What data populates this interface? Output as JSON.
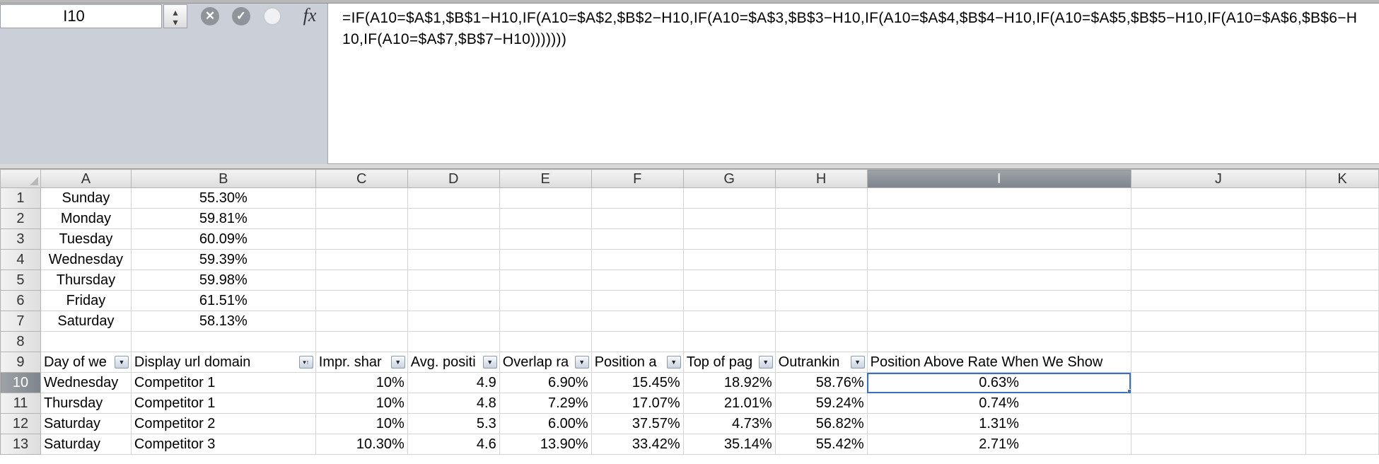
{
  "name_box": {
    "value": "I10"
  },
  "formula_bar": {
    "fx_label": "fx",
    "formula": "=IF(A10=$A$1,$B$1−H10,IF(A10=$A$2,$B$2−H10,IF(A10=$A$3,$B$3−H10,IF(A10=$A$4,$B$4−H10,IF(A10=$A$5,$B$5−H10,IF(A10=$A$6,$B$6−H10,IF(A10=$A$7,$B$7−H10)))))))"
  },
  "icons": {
    "cancel": "close-icon",
    "enter": "check-icon",
    "function": "function-icon",
    "stepper": "stepper-icon"
  },
  "colors": {
    "selection": "#3a6fc4",
    "filter_button": "#c9d3df"
  },
  "columns": [
    "A",
    "B",
    "C",
    "D",
    "E",
    "F",
    "G",
    "H",
    "I",
    "J",
    "K"
  ],
  "selected_column": "I",
  "selected_row": "10",
  "rows": [
    {
      "num": "1",
      "A": "Sunday",
      "B": "55.30%"
    },
    {
      "num": "2",
      "A": "Monday",
      "B": "59.81%"
    },
    {
      "num": "3",
      "A": "Tuesday",
      "B": "60.09%"
    },
    {
      "num": "4",
      "A": "Wednesday",
      "B": "59.39%"
    },
    {
      "num": "5",
      "A": "Thursday",
      "B": "59.98%"
    },
    {
      "num": "6",
      "A": "Friday",
      "B": "61.51%"
    },
    {
      "num": "7",
      "A": "Saturday",
      "B": "58.13%"
    },
    {
      "num": "8"
    }
  ],
  "table_header": {
    "num": "9",
    "A": "Day of we",
    "B": "Display url domain",
    "C": "Impr. shar",
    "D": "Avg. positi",
    "E": "Overlap ra",
    "F": "Position a",
    "G": "Top of pag",
    "H": "Outrankin",
    "I": "Position Above Rate When We Show"
  },
  "table_rows": [
    {
      "num": "10",
      "A": "Wednesday",
      "B": "Competitor 1",
      "C": "10%",
      "D": "4.9",
      "E": "6.90%",
      "F": "15.45%",
      "G": "18.92%",
      "H": "58.76%",
      "I": "0.63%"
    },
    {
      "num": "11",
      "A": "Thursday",
      "B": "Competitor 1",
      "C": "10%",
      "D": "4.8",
      "E": "7.29%",
      "F": "17.07%",
      "G": "21.01%",
      "H": "59.24%",
      "I": "0.74%"
    },
    {
      "num": "12",
      "A": "Saturday",
      "B": "Competitor 2",
      "C": "10%",
      "D": "5.3",
      "E": "6.00%",
      "F": "37.57%",
      "G": "4.73%",
      "H": "56.82%",
      "I": "1.31%"
    },
    {
      "num": "13",
      "A": "Saturday",
      "B": "Competitor 3",
      "C": "10.30%",
      "D": "4.6",
      "E": "13.90%",
      "F": "33.42%",
      "G": "35.14%",
      "H": "55.42%",
      "I": "2.71%"
    }
  ]
}
